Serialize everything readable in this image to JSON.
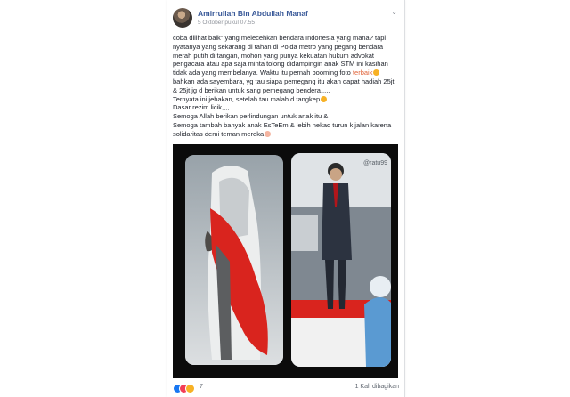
{
  "post": {
    "author": "Amirrullah Bin Abdullah Manaf",
    "timestamp": "5 Oktober pukul 07.55",
    "menu_icon": "chevron-down-icon",
    "lines": [
      "coba dilihat baik\" yang melecehkan bendara Indonesia yang mana? tapi",
      "nyatanya yang sekarang di tahan di Polda metro yang pegang bendara",
      "merah putih di tangan, mohon yang punya kekuatan hukum advokat",
      "pengacara atau apa saja minta tolong didampingin anak STM ini kasihan",
      "tidak ada yang membelanya. Waktu itu pernah booming foto",
      "bahkan ada sayembara, yg tau siapa pemegang itu akan dapat hadiah 25jt",
      "& 25jt jg d berikan untuk sang pemegang bendera,....",
      "Ternyata ini jebakan, setelah tau malah d tangkep",
      "Dasar rezim licik,,,,",
      "Semoga Allah berikan perlindungan untuk anak itu &",
      "Semoga tambah banyak anak EsTeEm & lebih nekad turun k jalan karena",
      "solidaritas demi teman mereka"
    ],
    "highlight_word": "terbaik",
    "photo_watermark": "@ratu99"
  },
  "footer": {
    "reaction_count": "7",
    "shares": "1 Kali dibagikan"
  },
  "colors": {
    "author": "#385898",
    "highlight": "#e0643a",
    "flag_red": "#d9241e"
  }
}
